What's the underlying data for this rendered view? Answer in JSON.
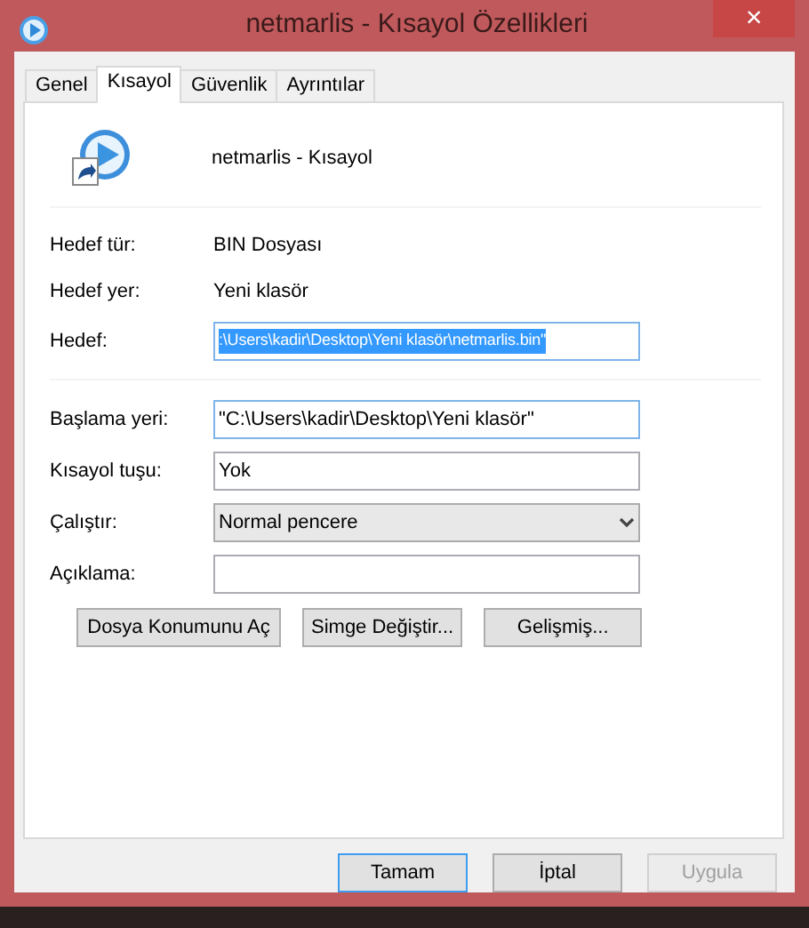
{
  "window": {
    "title": "netmarlis - Kısayol Özellikleri",
    "close": "×"
  },
  "tabs": [
    {
      "label": "Genel",
      "selected": false
    },
    {
      "label": "Kısayol",
      "selected": true
    },
    {
      "label": "Güvenlik",
      "selected": false
    },
    {
      "label": "Ayrıntılar",
      "selected": false
    }
  ],
  "header": {
    "name": "netmarlis - Kısayol"
  },
  "info": [
    {
      "label": "Hedef tür:",
      "value": "BIN Dosyası"
    },
    {
      "label": "Hedef yer:",
      "value": "Yeni klasör"
    }
  ],
  "target": {
    "label": "Hedef:",
    "value": ":\\Users\\kadir\\Desktop\\Yeni klasör\\netmarlis.bin\"",
    "selected": true
  },
  "fields": [
    {
      "kind": "text",
      "label": "Başlama yeri:",
      "value": "\"C:\\Users\\kadir\\Desktop\\Yeni klasör\"",
      "focused": true
    },
    {
      "kind": "text",
      "label": "Kısayol tuşu:",
      "value": "Yok",
      "focused": false
    },
    {
      "kind": "select",
      "label": "Çalıştır:",
      "value": "Normal pencere"
    },
    {
      "kind": "text",
      "label": "Açıklama:",
      "focused": false
    }
  ],
  "actions": [
    "Dosya Konumunu Aç",
    "Simge Değiştir...",
    "Gelişmiş..."
  ],
  "buttons": [
    {
      "label": "Tamam",
      "default": true,
      "disabled": false
    },
    {
      "label": "İptal",
      "default": false,
      "disabled": false
    },
    {
      "label": "Uygula",
      "default": false,
      "disabled": true
    }
  ]
}
